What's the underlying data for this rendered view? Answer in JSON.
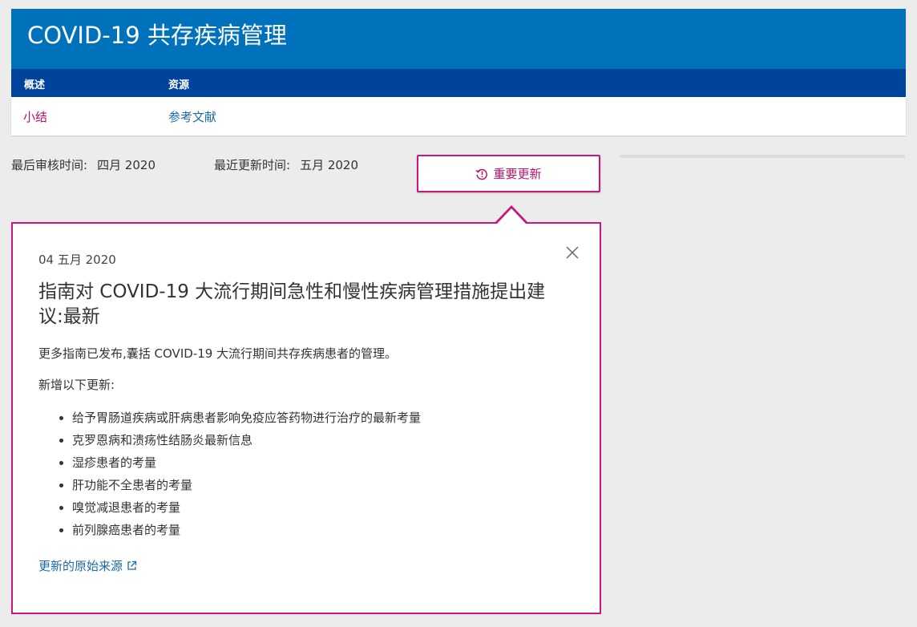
{
  "header": {
    "title": "COVID-19 共存疾病管理"
  },
  "nav": {
    "overview": "概述",
    "resources": "资源"
  },
  "subnav": {
    "summary": "小结",
    "references": "参考文献"
  },
  "meta": {
    "reviewed_label": "最后审核时间:",
    "reviewed_value": "四月 2020",
    "updated_label": "最近更新时间:",
    "updated_value": "五月 2020"
  },
  "updates_button": {
    "label": "重要更新",
    "icon": "history-alert-icon"
  },
  "popover": {
    "date": "04 五月 2020",
    "title": "指南对 COVID-19 大流行期间急性和慢性疾病管理措施提出建议:最新",
    "description": "更多指南已发布,囊括 COVID-19 大流行期间共存疾病患者的管理。",
    "subheading": "新增以下更新:",
    "items": [
      "给予胃肠道疾病或肝病患者影响免疫应答药物进行治疗的最新考量",
      "克罗恩病和溃疡性结肠炎最新信息",
      "湿疹患者的考量",
      "肝功能不全患者的考量",
      "嗅觉减退患者的考量",
      "前列腺癌患者的考量"
    ],
    "source_link": "更新的原始来源",
    "close_icon": "close-icon"
  },
  "colors": {
    "header": "#0072bc",
    "navbar": "#00439c",
    "accent": "#c8177e",
    "link": "#1c6aa8"
  }
}
